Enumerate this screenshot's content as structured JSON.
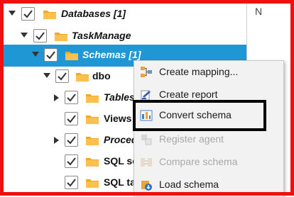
{
  "tree": {
    "items": [
      {
        "label": "Databases [1]",
        "expanded": true,
        "checked": true,
        "selected": false
      },
      {
        "label": "TaskManage",
        "expanded": true,
        "checked": true,
        "selected": false
      },
      {
        "label": "Schemas [1]",
        "expanded": true,
        "checked": true,
        "selected": true
      },
      {
        "label": "dbo",
        "expanded": true,
        "checked": true,
        "selected": false
      },
      {
        "label": "Tables",
        "expanded": false,
        "checked": true,
        "selected": false
      },
      {
        "label": "Views",
        "expanded": false,
        "checked": true,
        "selected": false
      },
      {
        "label": "Proced",
        "expanded": false,
        "checked": true,
        "selected": false
      },
      {
        "label": "SQL sc",
        "expanded": false,
        "checked": true,
        "selected": false
      },
      {
        "label": "SQL ta",
        "expanded": false,
        "checked": true,
        "selected": false
      }
    ]
  },
  "right_pane": {
    "letter": "N"
  },
  "context_menu": {
    "items": [
      {
        "label": "Create mapping...",
        "icon": "mapping-icon",
        "enabled": true
      },
      {
        "label": "Create report",
        "icon": "report-icon",
        "enabled": true
      },
      {
        "label": "Convert schema",
        "icon": "convert-schema-icon",
        "enabled": true,
        "highlighted": true
      },
      {
        "label": "Register agent",
        "icon": "register-agent-icon",
        "enabled": false
      },
      {
        "label": "Compare schema",
        "icon": "compare-schema-icon",
        "enabled": false
      },
      {
        "label": "Load schema",
        "icon": "load-schema-icon",
        "enabled": true
      }
    ]
  },
  "colors": {
    "selection": "#1f97d4",
    "frame": "#ee1111",
    "folder": "#f5a623",
    "highlight_box": "#000000"
  }
}
